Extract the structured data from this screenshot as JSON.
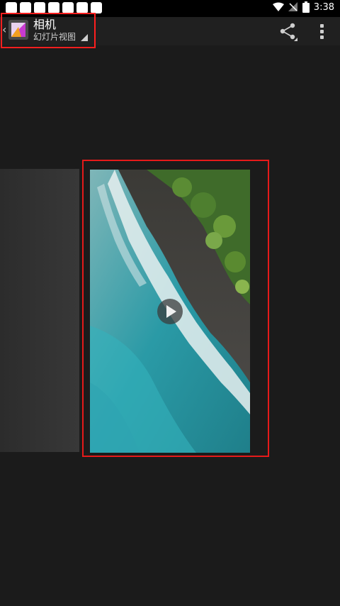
{
  "status_bar": {
    "time": "3:38",
    "notification_count": 7
  },
  "action_bar": {
    "title": "相机",
    "subtitle": "幻灯片视图",
    "share_icon": "share-icon",
    "overflow_icon": "more-vert-icon"
  },
  "content": {
    "play_icon": "play-icon"
  },
  "colors": {
    "highlight": "#e61a1a",
    "background": "#1b1b1b",
    "actionbar": "#202020"
  }
}
